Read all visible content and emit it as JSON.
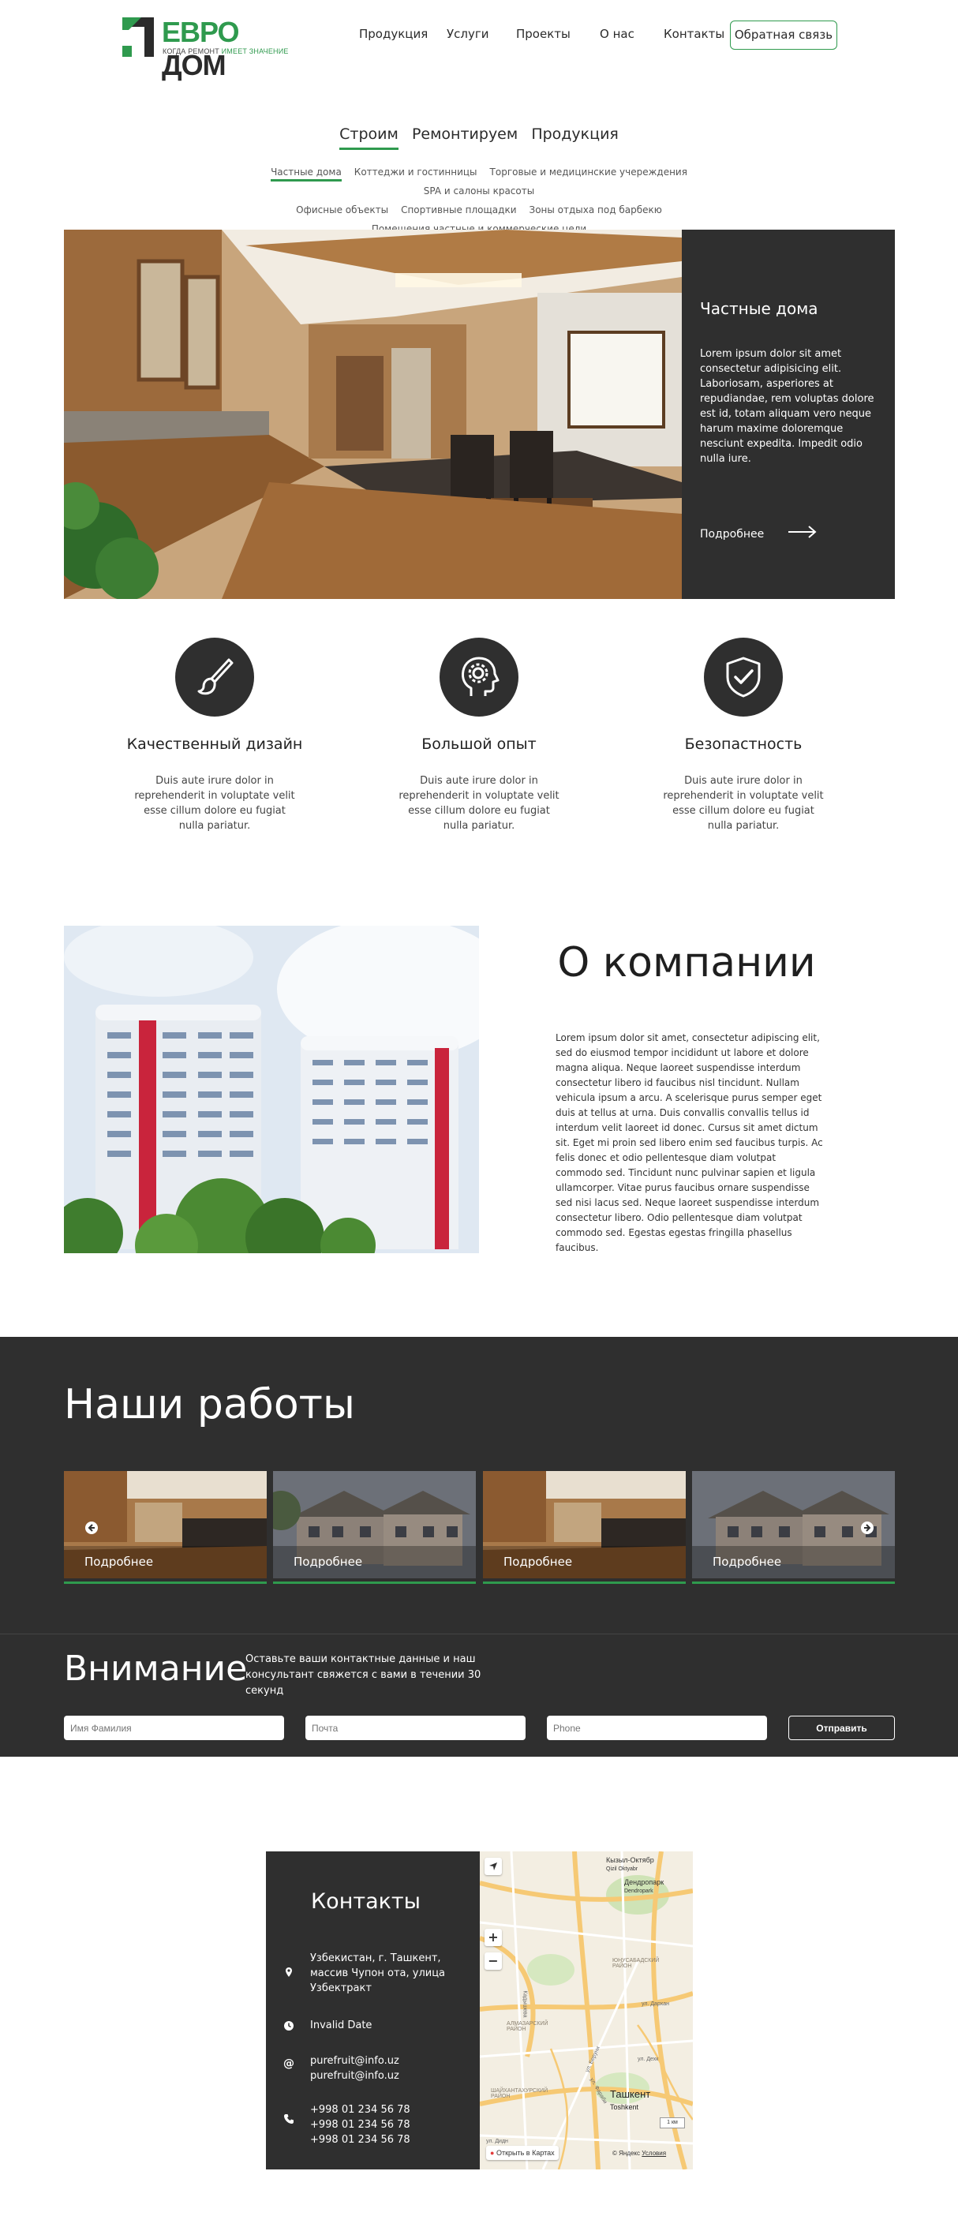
{
  "brand": {
    "title_a": "ЕВРО",
    "title_b": "ДОМ",
    "tagline_a": "КОГДА РЕМОНТ",
    "tagline_b": "ИМЕЕТ ЗНАЧЕНИЕ",
    "accent": "#2f9a4e",
    "dark": "#2f2f2f"
  },
  "nav": {
    "items": [
      "Продукция",
      "Услуги",
      "Проекты",
      "О нас",
      "Контакты"
    ],
    "cta": "Обратная связь"
  },
  "tabs": {
    "items": [
      "Строим",
      "Ремонтируем",
      "Продукция"
    ],
    "active": "Строим"
  },
  "subcategories": [
    "Частные дома",
    "Коттеджи и гостинницы",
    "Торговые и медицинские учереждения",
    "SPA и салоны красоты",
    "Офисные объекты",
    "Спортивные площадки",
    "Зоны отдыха под барбекю",
    "Помещения частные и коммерческие цели"
  ],
  "hero": {
    "title": "Частные дома",
    "text": "Lorem ipsum dolor sit amet consectetur adipisicing elit. Laboriosam, asperiores at repudiandae, rem voluptas dolore est id, totam aliquam vero neque harum maxime doloremque nesciunt expedita. Impedit odio nulla iure.",
    "more": "Подробнее",
    "arrow_icon": "arrow-right-icon"
  },
  "features": [
    {
      "icon": "paintbrush-icon",
      "title": "Качественный дизайн",
      "text": "Duis aute irure dolor in reprehenderit in voluptate velit esse cillum dolore eu fugiat nulla pariatur."
    },
    {
      "icon": "head-gear-icon",
      "title": "Большой опыт",
      "text": "Duis aute irure dolor in reprehenderit in voluptate velit esse cillum dolore eu fugiat nulla pariatur."
    },
    {
      "icon": "shield-check-icon",
      "title": "Безопастность",
      "text": "Duis aute irure dolor in reprehenderit in voluptate velit esse cillum dolore eu fugiat nulla pariatur."
    }
  ],
  "about": {
    "title": "О компании",
    "text": "Lorem ipsum dolor sit amet, consectetur adipiscing elit, sed do eiusmod tempor incididunt ut labore et dolore magna aliqua. Neque laoreet suspendisse interdum consectetur libero id faucibus nisl tincidunt. Nullam vehicula ipsum a arcu. A scelerisque purus semper eget duis at tellus at urna. Duis convallis convallis tellus id interdum velit laoreet id donec. Cursus sit amet dictum sit. Eget mi proin sed libero enim sed faucibus turpis. Ac felis donec et odio pellentesque diam volutpat commodo sed. Tincidunt nunc pulvinar sapien et ligula ullamcorper. Vitae purus faucibus ornare suspendisse sed nisi lacus sed. Neque laoreet suspendisse interdum consectetur libero. Odio pellentesque diam volutpat commodo sed. Egestas egestas fringilla phasellus faucibus."
  },
  "works": {
    "title": "Наши работы",
    "items": [
      {
        "label": "Подробнее",
        "kind": "interior"
      },
      {
        "label": "Подробнее",
        "kind": "house"
      },
      {
        "label": "Подробнее",
        "kind": "interior"
      },
      {
        "label": "Подробнее",
        "kind": "house"
      }
    ]
  },
  "attention": {
    "title": "Внимание",
    "text": "Оставьте ваши контактные данные и наш консультант свяжется с вами в течении 30 секунд",
    "name_placeholder": "Имя Фамилия",
    "email_placeholder": "Почта",
    "phone_placeholder": "Phone",
    "submit": "Отправить"
  },
  "contacts": {
    "title": "Контакты",
    "address": "Узбекистан, г. Ташкент, массив Чупон ота, улица Узбектракт",
    "hours": "Invalid Date",
    "email_1": "purefruit@info.uz",
    "email_2": "purefruit@info.uz",
    "phone_1": "+998 01 234 56 78",
    "phone_2": "+998 01 234 56 78",
    "phone_3": "+998 01 234 56 78"
  },
  "map": {
    "label_1": "Кызыл-Октябр",
    "label_1b": "Qizil Oktyabr",
    "label_2": "Дендропарк",
    "label_2b": "Dendropark",
    "label_3": "ЮНУСАБАДСКИЙ РАЙОН",
    "label_4": "АЛМАЗАРСКИЙ РАЙОН",
    "label_5": "ШАЙХАНТАХУРСКИЙ РАЙОН",
    "label_6": "Ташкент",
    "label_6b": "Toshkent",
    "label_7": "ул. Беруни",
    "label_8": "ул. Фараби",
    "label_9": "ул. Дехк",
    "label_10": "ул. Дидн",
    "label_11": "ул. Дархан",
    "label_12": "Кадышева",
    "open_label": "Открыть в Картах",
    "footer": "© Яндекс",
    "footer_link": "Условия",
    "zoom_in": "+",
    "zoom_out": "−",
    "scale": "1 км"
  }
}
